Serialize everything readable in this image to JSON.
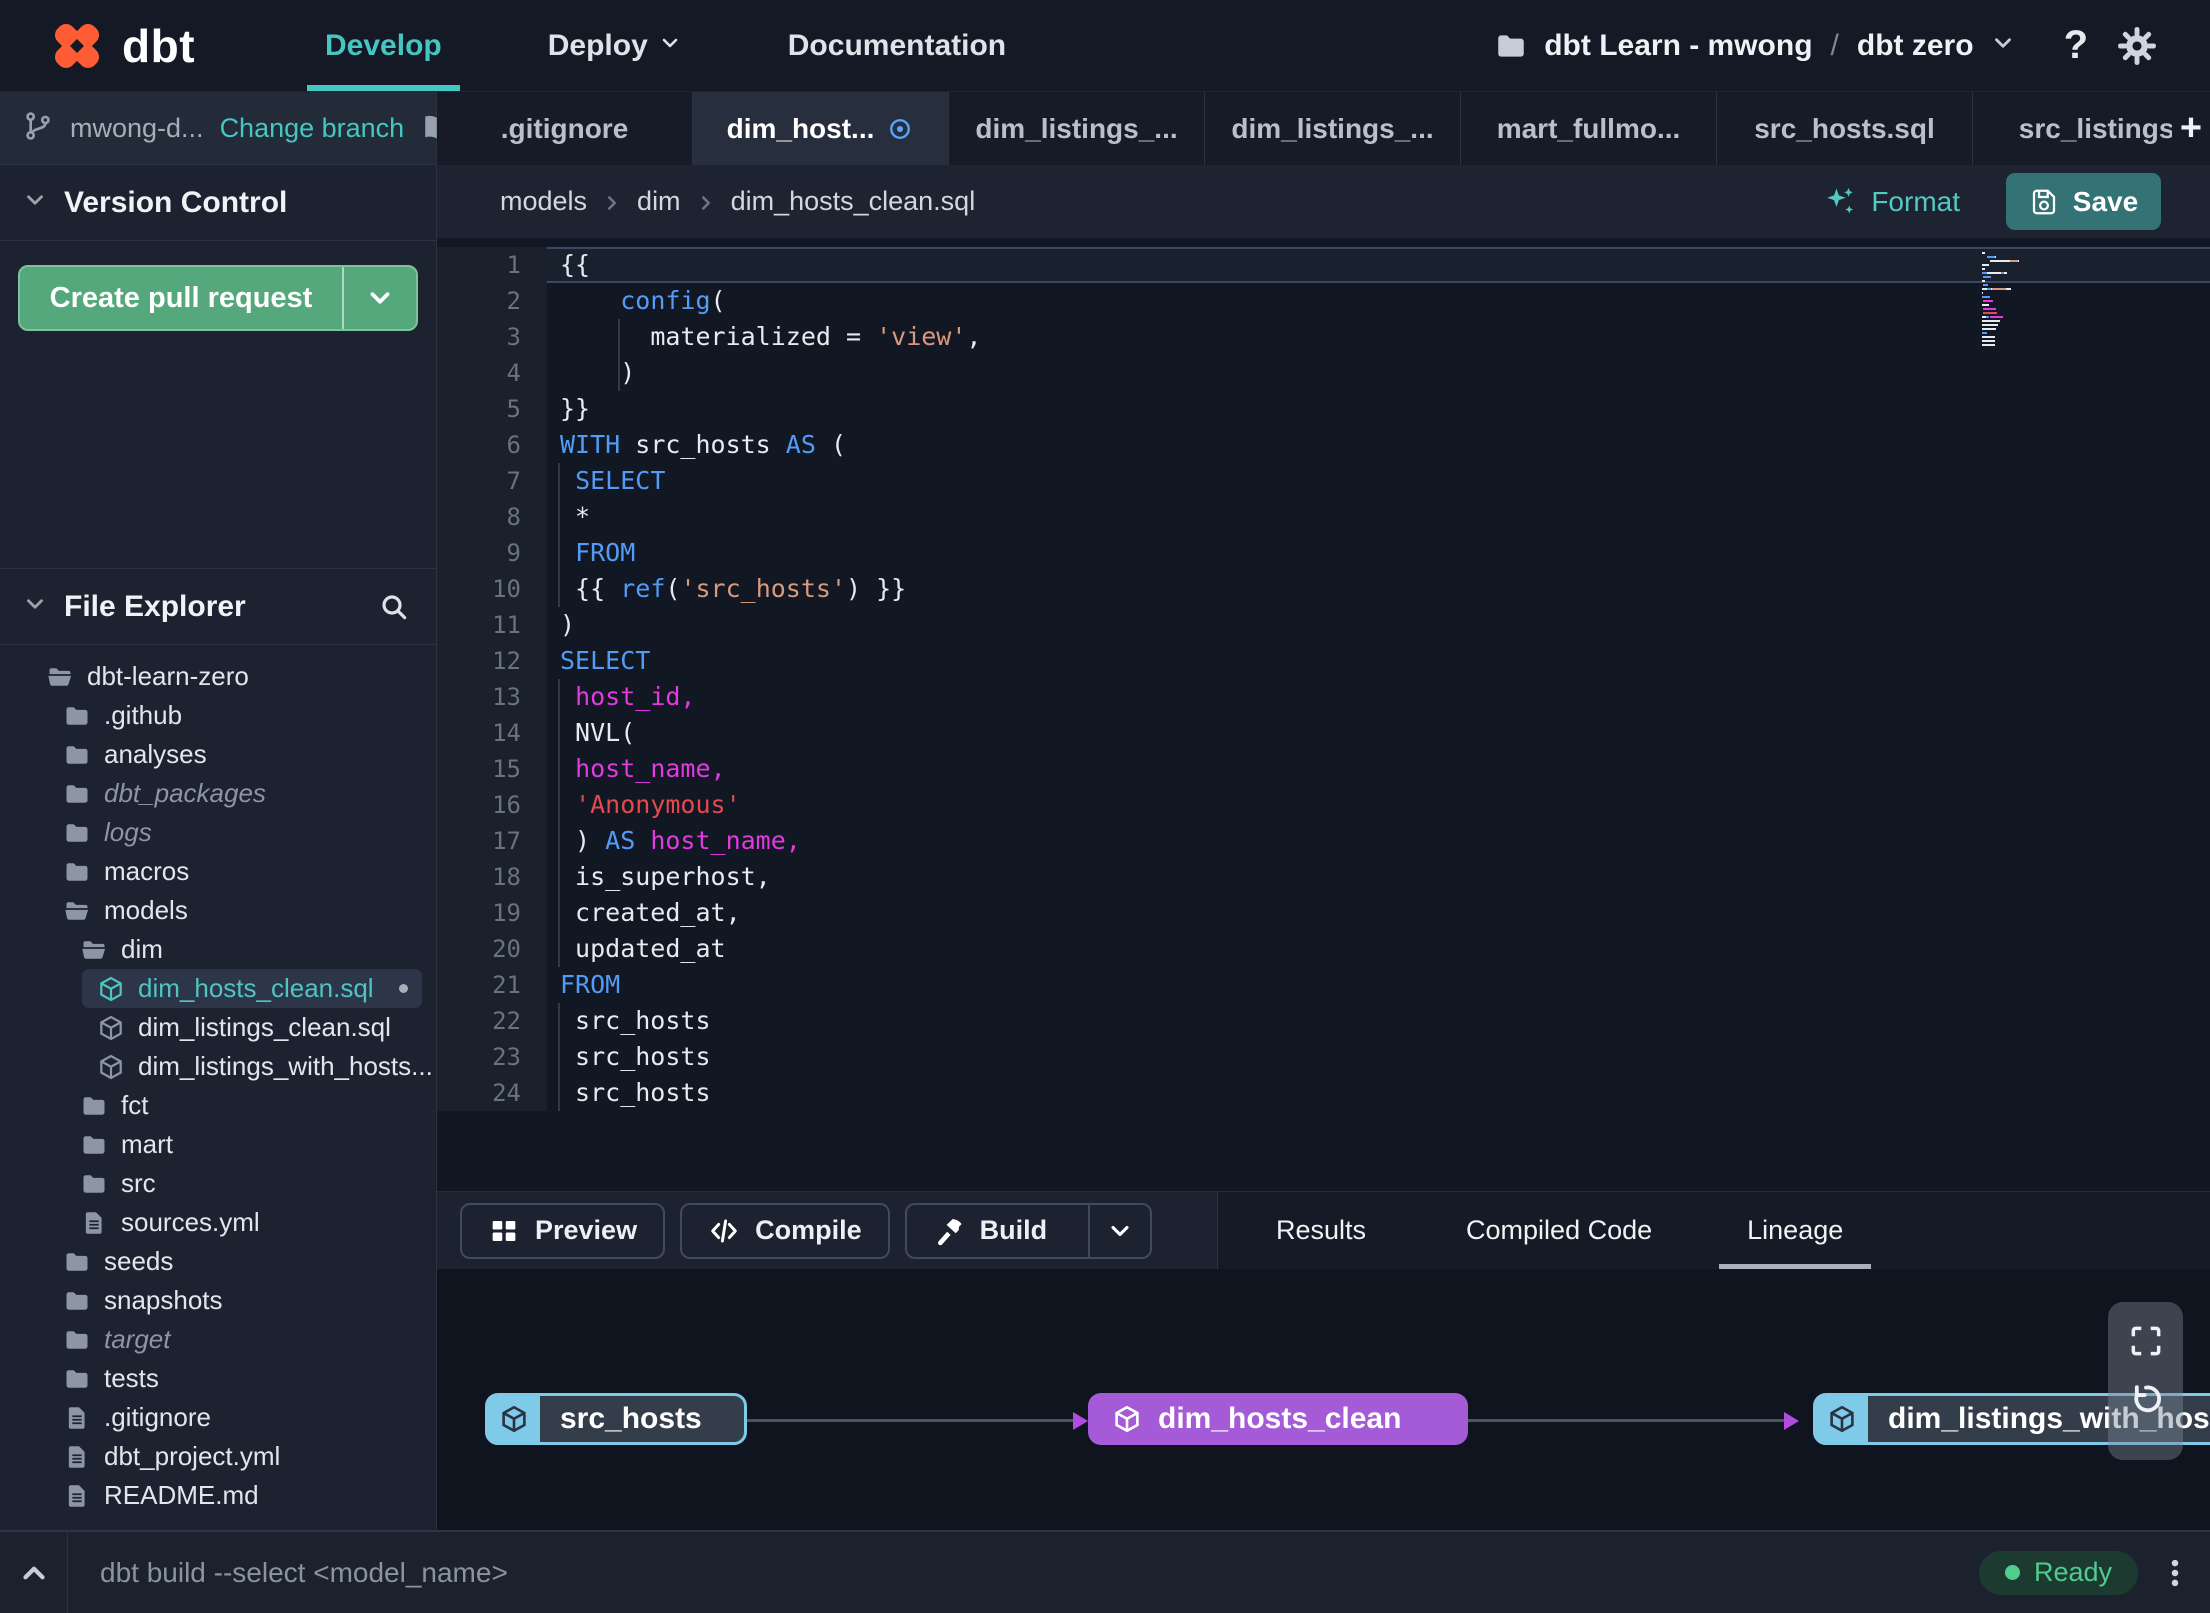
{
  "colors": {
    "accent_teal": "#45c6c1",
    "brand_orange": "#ff5c35",
    "save_teal": "#337376",
    "pr_green": "#55a87c",
    "node_blue": "#7fc9e9",
    "node_purple": "#a55ad8",
    "arrow_purple": "#b44be0",
    "status_green": "#4ecd8e",
    "modified_blue": "#58a6ff",
    "syntax": {
      "p": "#e7eaee",
      "k": "#539bf5",
      "s": "#d99a7c",
      "i": "#e03ae0",
      "r": "#e5484d"
    }
  },
  "topnav": {
    "brand": "dbt",
    "items": [
      {
        "label": "Develop",
        "active": true,
        "chevron": false
      },
      {
        "label": "Deploy",
        "active": false,
        "chevron": true
      },
      {
        "label": "Documentation",
        "active": false,
        "chevron": false
      }
    ],
    "project_selector": {
      "account": "dbt Learn - mwong",
      "separator": "/",
      "project": "dbt zero"
    },
    "help_label": "?"
  },
  "sidebar": {
    "branch": {
      "name": "mwong-d...",
      "action_label": "Change branch"
    },
    "version_control": {
      "title": "Version Control",
      "create_pr_label": "Create pull request"
    },
    "file_explorer": {
      "title": "File Explorer"
    },
    "tree": [
      {
        "label": "dbt-learn-zero",
        "icon": "folder-open",
        "level": 0
      },
      {
        "label": ".github",
        "icon": "folder",
        "level": 1
      },
      {
        "label": "analyses",
        "icon": "folder",
        "level": 1
      },
      {
        "label": "dbt_packages",
        "icon": "folder",
        "level": 1,
        "italic": true
      },
      {
        "label": "logs",
        "icon": "folder",
        "level": 1,
        "italic": true
      },
      {
        "label": "macros",
        "icon": "folder",
        "level": 1
      },
      {
        "label": "models",
        "icon": "folder-open",
        "level": 1
      },
      {
        "label": "dim",
        "icon": "folder-open",
        "level": 2
      },
      {
        "label": "dim_hosts_clean.sql",
        "icon": "model",
        "level": 3,
        "selected": true,
        "modified": true
      },
      {
        "label": "dim_listings_clean.sql",
        "icon": "model",
        "level": 3
      },
      {
        "label": "dim_listings_with_hosts...",
        "icon": "model",
        "level": 3
      },
      {
        "label": "fct",
        "icon": "folder",
        "level": 2
      },
      {
        "label": "mart",
        "icon": "folder",
        "level": 2
      },
      {
        "label": "src",
        "icon": "folder",
        "level": 2
      },
      {
        "label": "sources.yml",
        "icon": "file",
        "level": 2
      },
      {
        "label": "seeds",
        "icon": "folder",
        "level": 1
      },
      {
        "label": "snapshots",
        "icon": "folder",
        "level": 1
      },
      {
        "label": "target",
        "icon": "folder",
        "level": 1,
        "italic": true
      },
      {
        "label": "tests",
        "icon": "folder",
        "level": 1
      },
      {
        "label": ".gitignore",
        "icon": "file",
        "level": 1
      },
      {
        "label": "dbt_project.yml",
        "icon": "file",
        "level": 1
      },
      {
        "label": "README.md",
        "icon": "file",
        "level": 1
      }
    ]
  },
  "tabs": {
    "new_tab_label": "+",
    "items": [
      {
        "label": ".gitignore",
        "active": false,
        "modified": false
      },
      {
        "label": "dim_host...",
        "active": true,
        "modified": true
      },
      {
        "label": "dim_listings_...",
        "active": false,
        "modified": false
      },
      {
        "label": "dim_listings_...",
        "active": false,
        "modified": false
      },
      {
        "label": "mart_fullmo...",
        "active": false,
        "modified": false
      },
      {
        "label": "src_hosts.sql",
        "active": false,
        "modified": false
      },
      {
        "label": "src_listings.",
        "active": false,
        "modified": false
      }
    ]
  },
  "editor": {
    "breadcrumb": [
      "models",
      "dim",
      "dim_hosts_clean.sql"
    ],
    "format_label": "Format",
    "save_label": "Save",
    "lines": [
      {
        "n": 1,
        "current": true,
        "tokens": [
          {
            "t": "{{",
            "c": "p"
          }
        ]
      },
      {
        "n": 2,
        "tokens": [
          {
            "t": "    ",
            "c": "p"
          },
          {
            "t": "config",
            "c": "k"
          },
          {
            "t": "(",
            "c": "p"
          }
        ]
      },
      {
        "n": 3,
        "tokens": [
          {
            "t": "      ",
            "c": "p"
          },
          {
            "t": "materialized = ",
            "c": "p"
          },
          {
            "t": "'view'",
            "c": "s"
          },
          {
            "t": ",",
            "c": "p"
          }
        ]
      },
      {
        "n": 4,
        "tokens": [
          {
            "t": "    )",
            "c": "p"
          }
        ]
      },
      {
        "n": 5,
        "tokens": [
          {
            "t": "}}",
            "c": "p"
          }
        ]
      },
      {
        "n": 6,
        "tokens": [
          {
            "t": "WITH",
            "c": "k"
          },
          {
            "t": " src_hosts ",
            "c": "p"
          },
          {
            "t": "AS",
            "c": "k"
          },
          {
            "t": " (",
            "c": "p"
          }
        ]
      },
      {
        "n": 7,
        "tokens": [
          {
            "t": " ",
            "c": "p"
          },
          {
            "t": "SELECT",
            "c": "k"
          }
        ]
      },
      {
        "n": 8,
        "tokens": [
          {
            "t": " *",
            "c": "p"
          }
        ]
      },
      {
        "n": 9,
        "tokens": [
          {
            "t": " ",
            "c": "p"
          },
          {
            "t": "FROM",
            "c": "k"
          }
        ]
      },
      {
        "n": 10,
        "tokens": [
          {
            "t": " {{ ",
            "c": "p"
          },
          {
            "t": "ref",
            "c": "k"
          },
          {
            "t": "(",
            "c": "p"
          },
          {
            "t": "'src_hosts'",
            "c": "s"
          },
          {
            "t": ") }}",
            "c": "p"
          }
        ]
      },
      {
        "n": 11,
        "tokens": [
          {
            "t": ")",
            "c": "p"
          }
        ]
      },
      {
        "n": 12,
        "tokens": [
          {
            "t": "SELECT",
            "c": "k"
          }
        ]
      },
      {
        "n": 13,
        "tokens": [
          {
            "t": " ",
            "c": "p"
          },
          {
            "t": "host_id,",
            "c": "i"
          }
        ]
      },
      {
        "n": 14,
        "tokens": [
          {
            "t": " NVL(",
            "c": "p"
          }
        ]
      },
      {
        "n": 15,
        "tokens": [
          {
            "t": " ",
            "c": "p"
          },
          {
            "t": "host_name,",
            "c": "i"
          }
        ]
      },
      {
        "n": 16,
        "tokens": [
          {
            "t": " ",
            "c": "p"
          },
          {
            "t": "'Anonymous'",
            "c": "r"
          }
        ]
      },
      {
        "n": 17,
        "tokens": [
          {
            "t": " ) ",
            "c": "p"
          },
          {
            "t": "AS",
            "c": "k"
          },
          {
            "t": " ",
            "c": "p"
          },
          {
            "t": "host_name,",
            "c": "i"
          }
        ]
      },
      {
        "n": 18,
        "tokens": [
          {
            "t": " is_superhost,",
            "c": "p"
          }
        ]
      },
      {
        "n": 19,
        "tokens": [
          {
            "t": " created_at,",
            "c": "p"
          }
        ]
      },
      {
        "n": 20,
        "tokens": [
          {
            "t": " updated_at",
            "c": "p"
          }
        ]
      },
      {
        "n": 21,
        "tokens": [
          {
            "t": "FROM",
            "c": "k"
          }
        ]
      },
      {
        "n": 22,
        "tokens": [
          {
            "t": " src_hosts",
            "c": "p"
          }
        ]
      },
      {
        "n": 23,
        "tokens": [
          {
            "t": " src_hosts",
            "c": "p"
          }
        ]
      },
      {
        "n": 24,
        "tokens": [
          {
            "t": " src_hosts",
            "c": "p"
          }
        ]
      }
    ]
  },
  "bottom_panel": {
    "actions": [
      {
        "label": "Preview",
        "icon": "grid-icon",
        "split": false
      },
      {
        "label": "Compile",
        "icon": "code-icon",
        "split": false
      },
      {
        "label": "Build",
        "icon": "hammer-icon",
        "split": true
      }
    ],
    "tabs": [
      {
        "label": "Results",
        "active": false
      },
      {
        "label": "Compiled Code",
        "active": false
      },
      {
        "label": "Lineage",
        "active": true
      }
    ],
    "lineage_nodes": [
      {
        "label": "src_hosts",
        "variant": "blue"
      },
      {
        "label": "dim_hosts_clean",
        "variant": "purple"
      },
      {
        "label": "dim_listings_with_hosts",
        "variant": "blue"
      }
    ]
  },
  "statusbar": {
    "command": "dbt build --select <model_name>",
    "status": "Ready"
  }
}
